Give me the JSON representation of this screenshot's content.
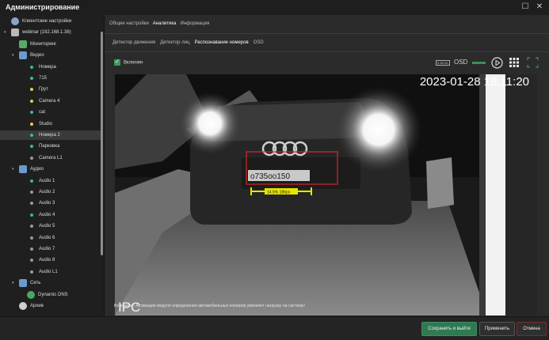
{
  "window": {
    "title": "Администрирование",
    "minimize_glyph": "☐",
    "close_glyph": "✕"
  },
  "sidebar": {
    "items": [
      {
        "label": "Клиентские настройки",
        "kind": "settings",
        "icon": "gear-icon"
      },
      {
        "label": "webinar (192.168.1.38)",
        "kind": "server",
        "icon": "server-icon"
      },
      {
        "label": "Мониторинг",
        "kind": "monitor",
        "icon": "monitoring-icon"
      },
      {
        "label": "Видео",
        "kind": "group",
        "icon": "video-icon"
      },
      {
        "label": "Номера",
        "dot": "#3bbd8a"
      },
      {
        "label": "715",
        "dot": "#3bbd8a"
      },
      {
        "label": "Грут",
        "dot": "#e8c84a"
      },
      {
        "label": "Camera 4",
        "dot": "#e8c84a"
      },
      {
        "label": "cat",
        "dot": "#3bbd8a"
      },
      {
        "label": "Studio",
        "dot": "#e8c84a"
      },
      {
        "label": "Номера 2",
        "dot": "#3bbd8a",
        "selected": true
      },
      {
        "label": "Парковка",
        "dot": "#3bbd8a"
      },
      {
        "label": "Camera L1",
        "dot": "#9a9a9a"
      },
      {
        "label": "Аудио",
        "kind": "group",
        "icon": "audio-icon"
      },
      {
        "label": "Audio 1",
        "dot": "#3bbd8a"
      },
      {
        "label": "Audio 2",
        "dot": "#9a9a9a"
      },
      {
        "label": "Audio 3",
        "dot": "#9a9a9a"
      },
      {
        "label": "Audio 4",
        "dot": "#3bbd8a"
      },
      {
        "label": "Audio 5",
        "dot": "#9a9a9a"
      },
      {
        "label": "Audio 6",
        "dot": "#9a9a9a"
      },
      {
        "label": "Audio 7",
        "dot": "#9a9a9a"
      },
      {
        "label": "Audio 8",
        "dot": "#9a9a9a"
      },
      {
        "label": "Audio L1",
        "dot": "#9a9a9a"
      },
      {
        "label": "Сеть",
        "kind": "group",
        "icon": "network-icon"
      },
      {
        "label": "Dynamic DNS",
        "kind": "ddns",
        "icon": "ddns-icon"
      },
      {
        "label": "Архив",
        "kind": "archive",
        "icon": "archive-icon"
      }
    ]
  },
  "tabs_top": [
    "Общие настройки",
    "Аналитика",
    "Информация"
  ],
  "tabs_top_active": 1,
  "tabs_sub": [
    "Детектор движения",
    "Детектор лиц",
    "Распознавание номеров",
    "OSD"
  ],
  "tabs_sub_active": 2,
  "enabled_label": "Включен",
  "toolbar": {
    "scale_label": "3.1E.M.",
    "osd_label": "OSD"
  },
  "video": {
    "timestamp": "2023-01-28 18:11:20",
    "brand": "IPC",
    "plate": "о735оо150",
    "measure_label": "14.5% 186px"
  },
  "warning": "Внимание! Активация модуля определения автомобильных номеров увеличит нагрузку на систему!",
  "buttons": {
    "save_exit": "Сохранить и выйти",
    "apply": "Применить",
    "cancel": "Отмена"
  },
  "colors": {
    "accent": "#2f7a52",
    "selection_box": "#d9252a",
    "measure": "#e6e600"
  }
}
